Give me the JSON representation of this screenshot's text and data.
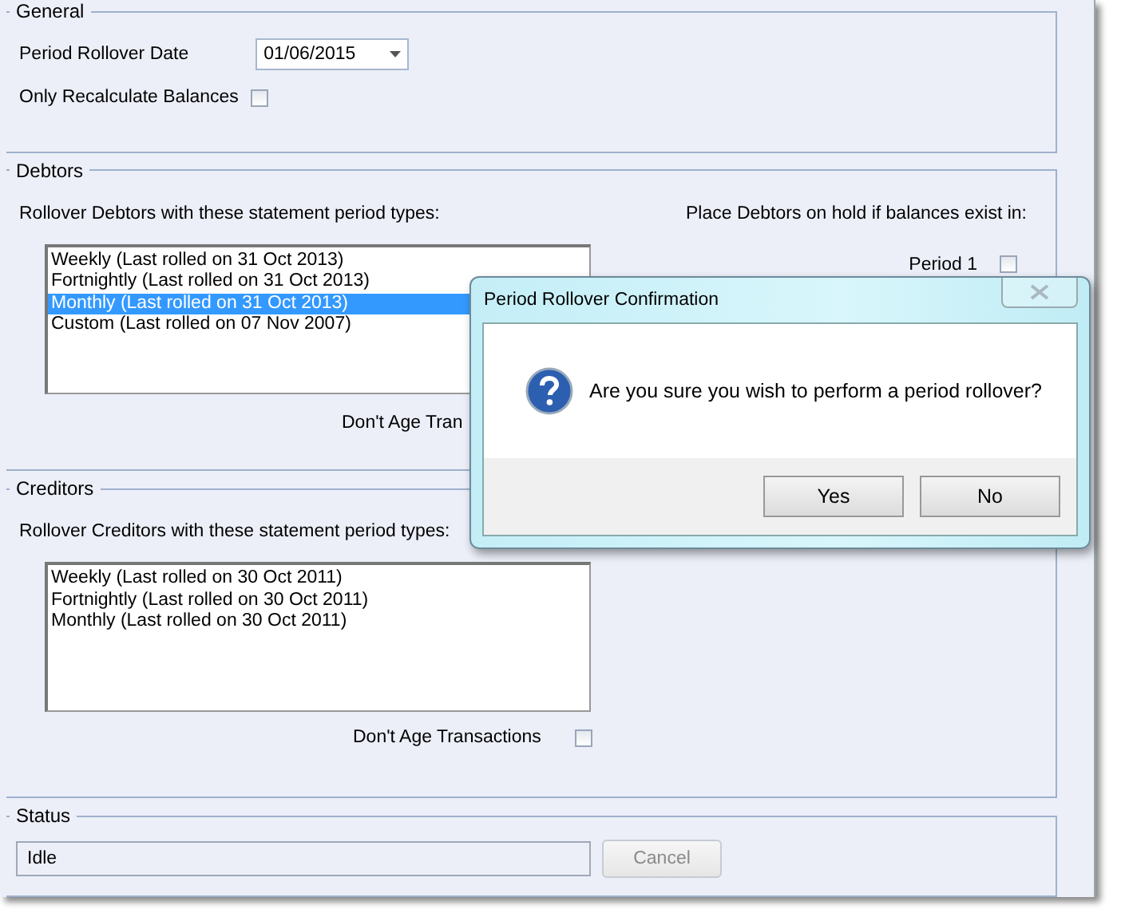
{
  "general": {
    "title": "General",
    "rollover_date": {
      "label": "Period Rollover Date",
      "value": "01/06/2015"
    },
    "only_recalculate": {
      "label": "Only Recalculate Balances",
      "checked": false
    }
  },
  "debtors": {
    "title": "Debtors",
    "list_label": "Rollover Debtors with these statement period types:",
    "items": [
      {
        "label": "Weekly (Last rolled on 31 Oct 2013)",
        "selected": false
      },
      {
        "label": "Fortnightly (Last rolled on 31 Oct 2013)",
        "selected": false
      },
      {
        "label": "Monthly (Last rolled on 31 Oct 2013)",
        "selected": true
      },
      {
        "label": "Custom (Last rolled on 07 Nov 2007)",
        "selected": false
      }
    ],
    "dont_age_label": "Don't Age Tran",
    "hold_label": "Place Debtors on hold if balances exist in:",
    "periods": [
      {
        "label": "Period 1",
        "checked": false
      }
    ]
  },
  "creditors": {
    "title": "Creditors",
    "list_label": "Rollover Creditors with these statement period types:",
    "items": [
      {
        "label": "Weekly (Last rolled on 30 Oct 2011)",
        "selected": false
      },
      {
        "label": "Fortnightly (Last rolled on 30 Oct 2011)",
        "selected": false
      },
      {
        "label": "Monthly (Last rolled on 30 Oct 2011)",
        "selected": false
      }
    ],
    "dont_age": {
      "label": "Don't Age Transactions",
      "checked": false
    }
  },
  "status": {
    "title": "Status",
    "value": "Idle",
    "cancel": {
      "label": "Cancel",
      "disabled": true
    }
  },
  "dialog": {
    "title": "Period Rollover Confirmation",
    "message": "Are you sure you wish to perform a period rollover?",
    "buttons": [
      "Yes",
      "No"
    ]
  }
}
